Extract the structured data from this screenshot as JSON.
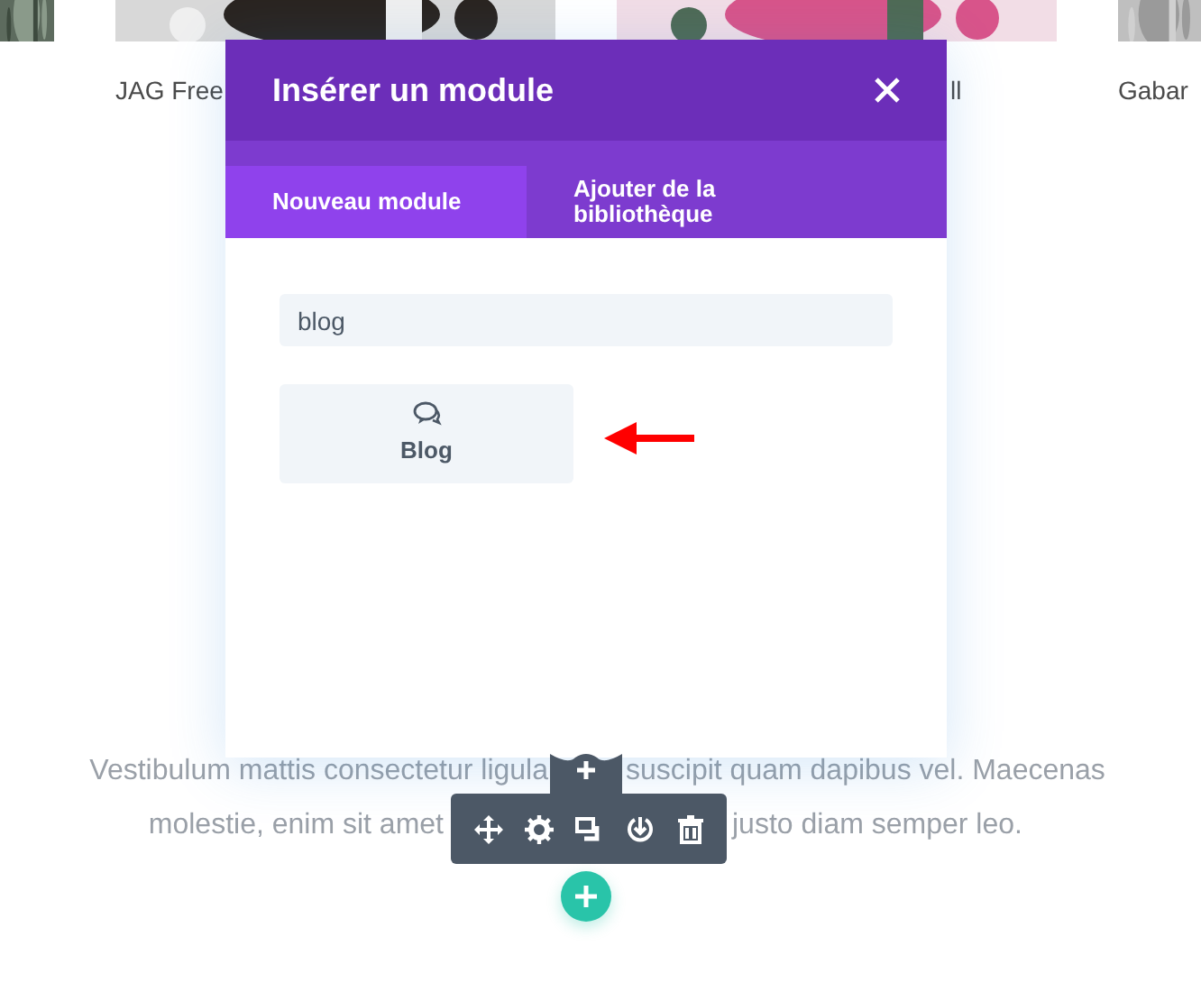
{
  "page": {
    "product_titles": [
      "JAG Free",
      "ll",
      "Gabar"
    ],
    "paragraph_lines": [
      [
        "Vestibulum mattis consectetur ligula",
        "suscipit quam dapibus vel. Maecenas"
      ],
      [
        "molestie, enim sit amet",
        "justo diam semper leo."
      ]
    ]
  },
  "modal": {
    "title": "Insérer un module",
    "tabs": [
      {
        "label": "Nouveau module",
        "selected": true
      },
      {
        "label": "Ajouter de la bibliothèque",
        "selected": false
      }
    ],
    "search": {
      "value": "blog"
    },
    "modules": [
      {
        "label": "Blog"
      }
    ]
  }
}
